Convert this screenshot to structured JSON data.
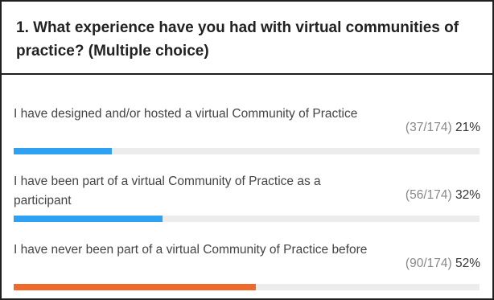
{
  "question": {
    "title": "1. What experience have you had with virtual communities of practice? (Multiple choice)"
  },
  "options": [
    {
      "label": "I have designed and/or hosted a virtual Community of Practice",
      "count": "(37/174)",
      "percent": "21%",
      "fraction": 0.21,
      "color": "#2ea1f3"
    },
    {
      "label": "I have been part of a virtual Community of Practice as a participant",
      "count": "(56/174)",
      "percent": "32%",
      "fraction": 0.32,
      "color": "#2ea1f3"
    },
    {
      "label": "I have never been part of a virtual Community of Practice before",
      "count": "(90/174)",
      "percent": "52%",
      "fraction": 0.52,
      "color": "#ef6a2a"
    }
  ]
}
